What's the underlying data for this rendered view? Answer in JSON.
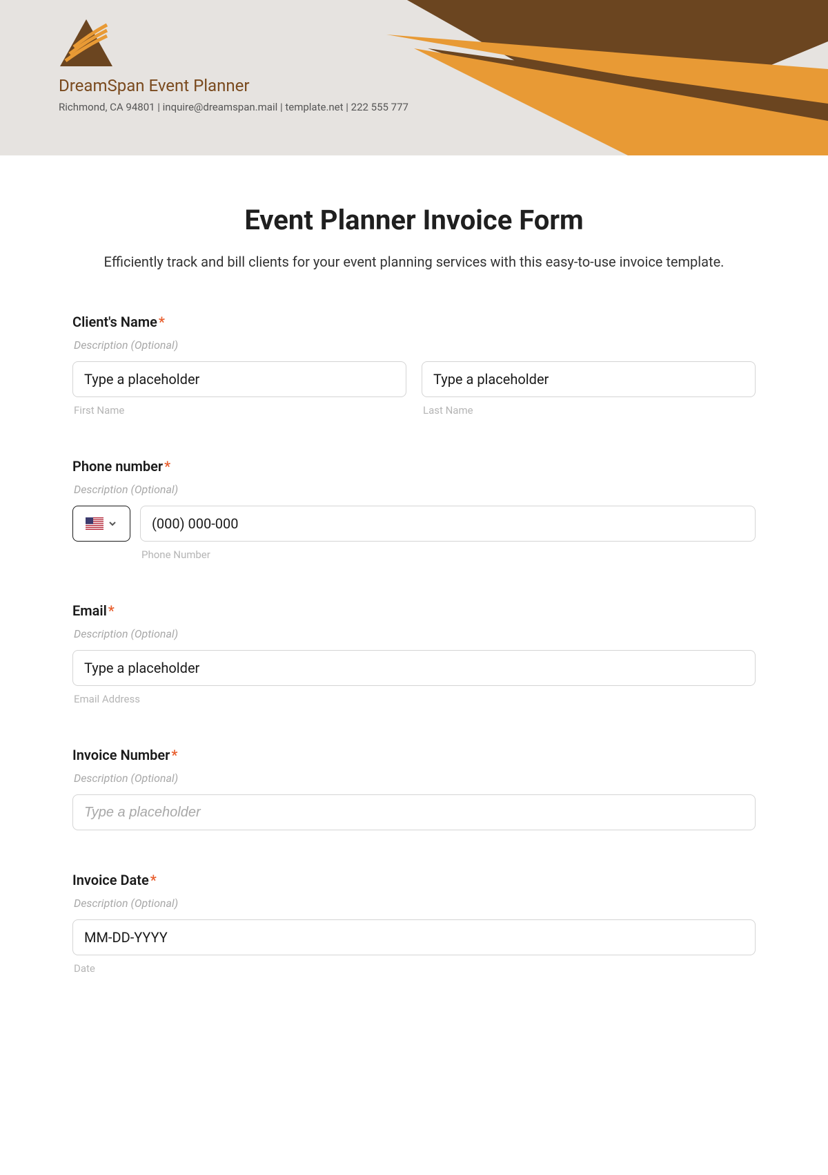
{
  "header": {
    "company_name": "DreamSpan Event Planner",
    "meta": "Richmond, CA 94801 | inquire@dreamspan.mail | template.net | 222 555 777"
  },
  "page": {
    "title": "Event Planner Invoice Form",
    "subtitle": "Efficiently track and bill clients for your event planning services with this easy-to-use invoice template."
  },
  "fields": {
    "client_name": {
      "label": "Client's Name",
      "desc": "Description (Optional)",
      "first_value": "Type a placeholder",
      "last_value": "Type a placeholder",
      "first_sub": "First Name",
      "last_sub": "Last Name"
    },
    "phone": {
      "label": "Phone number",
      "desc": "Description (Optional)",
      "value": "(000) 000-000",
      "sub": "Phone Number"
    },
    "email": {
      "label": "Email",
      "desc": "Description (Optional)",
      "value": "Type a placeholder",
      "sub": "Email Address"
    },
    "invoice_number": {
      "label": "Invoice Number",
      "desc": "Description (Optional)",
      "placeholder": "Type a placeholder"
    },
    "invoice_date": {
      "label": "Invoice Date",
      "desc": "Description (Optional)",
      "value": "MM-DD-YYYY",
      "sub": "Date"
    }
  }
}
